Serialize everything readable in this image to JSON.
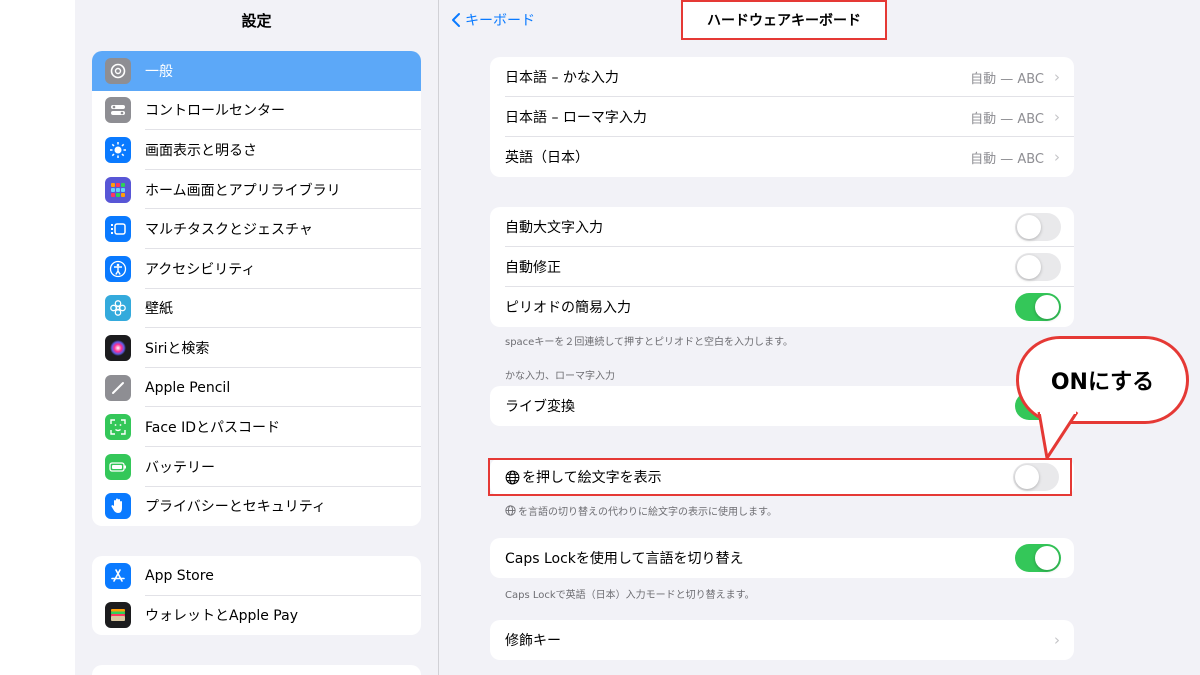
{
  "sidebar": {
    "title": "設定",
    "group1": [
      {
        "label": "一般",
        "icon": "gear-icon",
        "color": "#8e8e93",
        "selected": true
      },
      {
        "label": "コントロールセンター",
        "icon": "control-center-icon",
        "color": "#8e8e93"
      },
      {
        "label": "画面表示と明るさ",
        "icon": "brightness-icon",
        "color": "#0a7aff"
      },
      {
        "label": "ホーム画面とアプリライブラリ",
        "icon": "home-screen-icon",
        "color": "#5856d6"
      },
      {
        "label": "マルチタスクとジェスチャ",
        "icon": "multitask-icon",
        "color": "#0a7aff"
      },
      {
        "label": "アクセシビリティ",
        "icon": "accessibility-icon",
        "color": "#0a7aff"
      },
      {
        "label": "壁紙",
        "icon": "wallpaper-flower-icon",
        "color": "#34aadc"
      },
      {
        "label": "Siriと検索",
        "icon": "siri-icon",
        "color": "#1c1c1e"
      },
      {
        "label": "Apple Pencil",
        "icon": "pencil-icon",
        "color": "#8e8e93"
      },
      {
        "label": "Face IDとパスコード",
        "icon": "face-id-icon",
        "color": "#34c759"
      },
      {
        "label": "バッテリー",
        "icon": "battery-icon",
        "color": "#34c759"
      },
      {
        "label": "プライバシーとセキュリティ",
        "icon": "hand-icon",
        "color": "#0a7aff"
      }
    ],
    "group2": [
      {
        "label": "App Store",
        "icon": "app-store-icon",
        "color": "#0a7aff"
      },
      {
        "label": "ウォレットとApple Pay",
        "icon": "wallet-icon",
        "color": "#1c1c1e"
      }
    ]
  },
  "nav": {
    "back_label": "キーボード",
    "title": "ハードウェアキーボード"
  },
  "layouts": [
    {
      "label": "日本語 – かな入力",
      "detail": "自動 — ABC"
    },
    {
      "label": "日本語 – ローマ字入力",
      "detail": "自動 — ABC"
    },
    {
      "label": "英語（日本）",
      "detail": "自動 — ABC"
    }
  ],
  "toggles1": [
    {
      "label": "自動大文字入力",
      "on": false
    },
    {
      "label": "自動修正",
      "on": false
    },
    {
      "label": "ピリオドの簡易入力",
      "on": true
    }
  ],
  "period_note": "spaceキーを２回連続して押すとピリオドと空白を入力します。",
  "kana_header": "かな入力、ローマ字入力",
  "live_conversion": {
    "label": "ライブ変換",
    "on": true
  },
  "emoji": {
    "label": "を押して絵文字を表示",
    "on": false,
    "note": "を言語の切り替えの代わりに絵文字の表示に使用します。"
  },
  "capslock": {
    "label": "Caps Lockを使用して言語を切り替え",
    "on": true,
    "note": "Caps Lockで英語（日本）入力モードと切り替えます。"
  },
  "modifier": {
    "label": "修飾キー"
  },
  "callout": {
    "text": "ONにする",
    "color": "#e53935"
  }
}
